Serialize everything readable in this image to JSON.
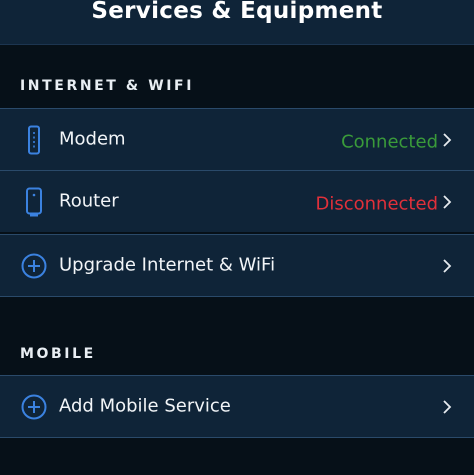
{
  "header": {
    "title": "Services & Equipment"
  },
  "sections": {
    "internet": {
      "label": "INTERNET & WIFI",
      "items": [
        {
          "label": "Modem",
          "status": "Connected",
          "icon": "modem-icon"
        },
        {
          "label": "Router",
          "status": "Disconnected",
          "icon": "router-icon"
        },
        {
          "label": "Upgrade Internet & WiFi",
          "icon": "plus-circle-icon"
        }
      ]
    },
    "mobile": {
      "label": "MOBILE",
      "items": [
        {
          "label": "Add Mobile Service",
          "icon": "plus-circle-icon"
        }
      ]
    }
  },
  "colors": {
    "accent": "#3b82e0",
    "connected": "#3a9b3a",
    "disconnected": "#e0303a",
    "row_background": "#0f2438",
    "page_background": "#061018"
  }
}
